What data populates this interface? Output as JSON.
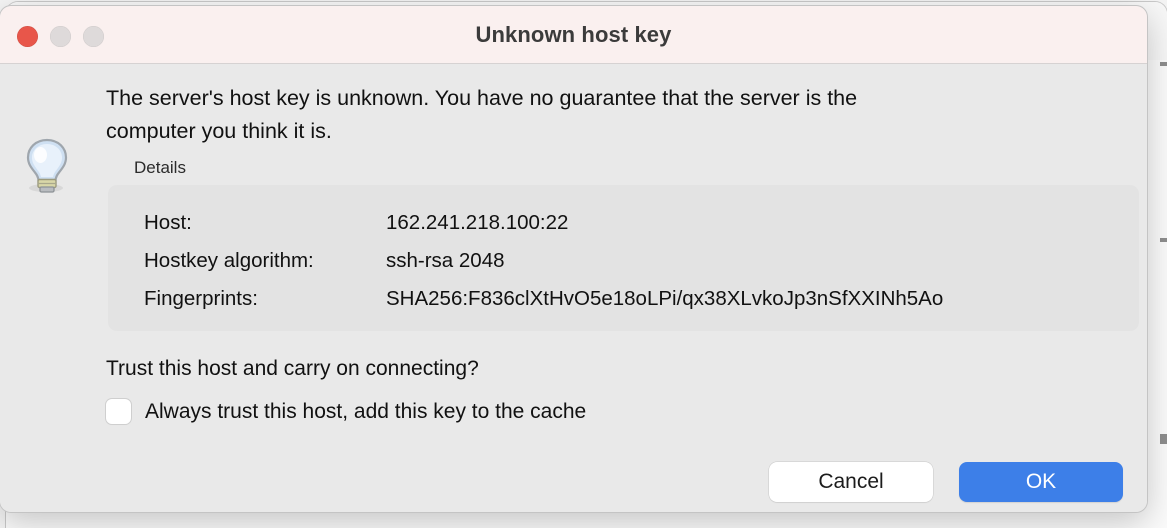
{
  "window": {
    "title": "Unknown host key",
    "traffic_lights": [
      {
        "name": "close",
        "color": "#e8564a"
      },
      {
        "name": "minimize",
        "color": "#dedada"
      },
      {
        "name": "zoom",
        "color": "#dedada"
      }
    ],
    "titlebar_color": "#faf0ef",
    "body_color": "#e9e9e9"
  },
  "icon": {
    "name": "lightbulb-icon"
  },
  "message": "The server's host key is unknown. You have no guarantee that the server is the computer you think it is.",
  "details": {
    "label": "Details",
    "rows": [
      {
        "key": "Host:",
        "value": "162.241.218.100:22"
      },
      {
        "key": "Hostkey algorithm:",
        "value": "ssh-rsa 2048"
      },
      {
        "key": "Fingerprints:",
        "value": "SHA256:F836clXtHvO5e18oLPi/qx38XLvkoJp3nSfXXINh5Ao"
      }
    ]
  },
  "question": "Trust this host and carry on connecting?",
  "checkbox": {
    "label": "Always trust this host, add this key to the cache",
    "checked": false
  },
  "buttons": {
    "cancel": "Cancel",
    "ok": "OK",
    "ok_color": "#3d7fe8"
  }
}
